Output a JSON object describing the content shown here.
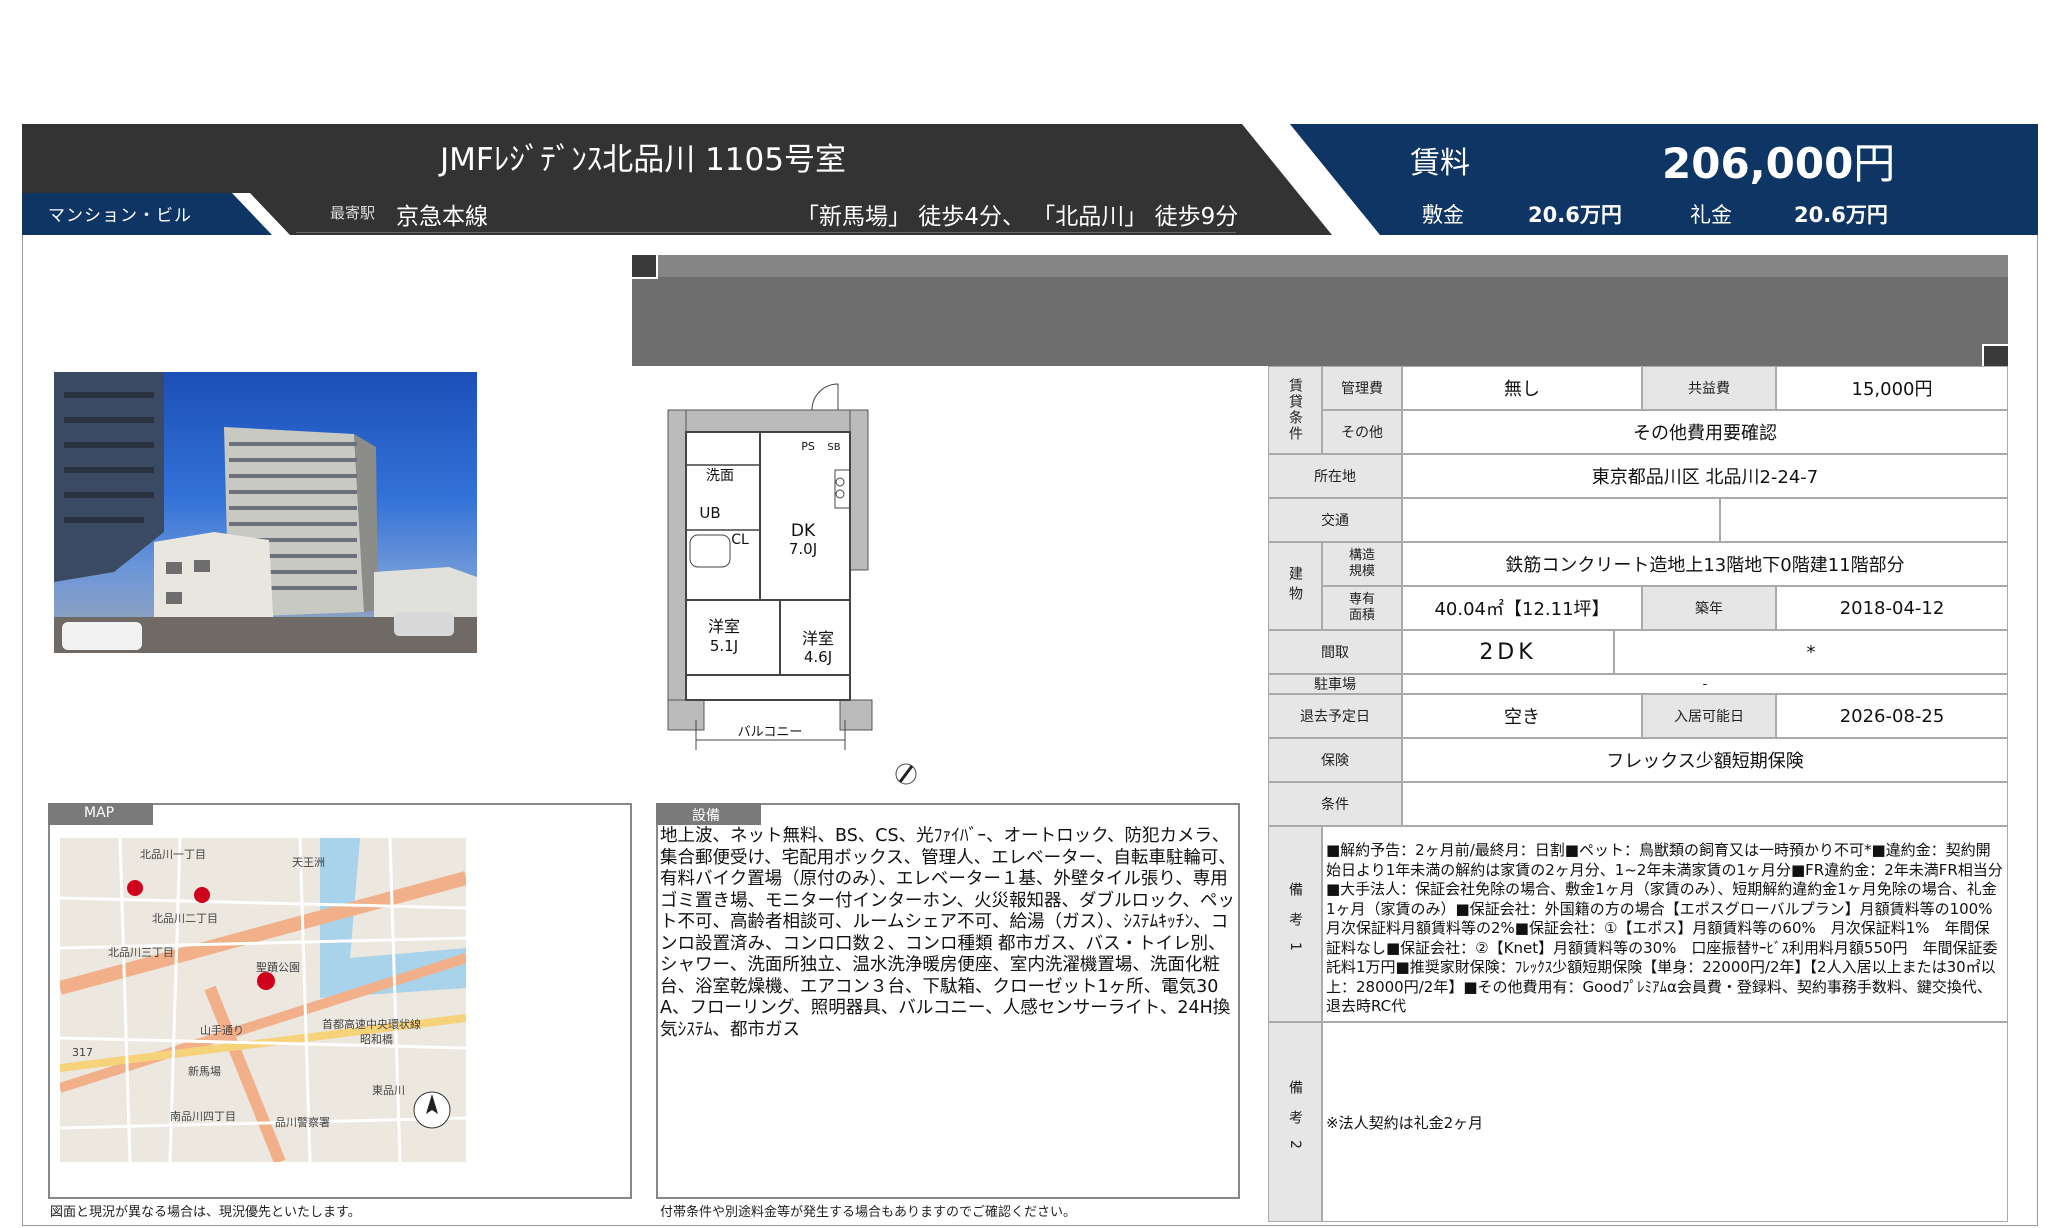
{
  "header": {
    "title": "JMFﾚｼﾞﾃﾞﾝｽ北品川 1105号室",
    "property_type": "マンション・ビル",
    "station_label": "最寄駅",
    "line": "京急本線",
    "access": "「新馬場」 徒歩4分、 「北品川」 徒歩9分",
    "rent_label": "賃料",
    "rent_value": "206,000",
    "rent_unit": "円",
    "deposit_label": "敷金",
    "deposit_value": "20.6万円",
    "key_money_label": "礼金",
    "key_money_value": "20.6万円"
  },
  "map_label": "MAP",
  "map_place_labels": [
    "天王洲",
    "北品川一丁目",
    "北品川二丁目",
    "北品川三丁目",
    "聖蹟公園",
    "山手通り",
    "首都高速中央環状線",
    "新馬場",
    "南品川四丁目",
    "東品川",
    "317",
    "昭和橋",
    "品川警察署"
  ],
  "equipment_label": "設備",
  "equipment_text": "地上波、ネット無料、BS、CS、光ﾌｧｲﾊﾞｰ、オートロック、防犯カメラ、集合郵便受け、宅配用ボックス、管理人、エレベーター、自転車駐輪可、有料バイク置場（原付のみ）、エレベーター１基、外壁タイル張り、専用ゴミ置き場、モニター付インターホン、火災報知器、ダブルロック、ペット不可、高齢者相談可、ルームシェア不可、給湯（ガス）、ｼｽﾃﾑｷｯﾁﾝ、コンロ設置済み、コンロ口数２、コンロ種類 都市ガス、バス・トイレ別、シャワー、洗面所独立、温水洗浄暖房便座、室内洗濯機置場、洗面化粧台、浴室乾燥機、エアコン３台、下駄箱、クローゼット1ヶ所、電気30A、フローリング、照明器具、バルコニー、人感センサーライト、24H換気ｼｽﾃﾑ、都市ガス",
  "floorplan": {
    "rooms": [
      "洗面",
      "UB",
      "CL",
      "DK",
      "7.0J",
      "洋室",
      "5.1J",
      "洋室",
      "4.6J",
      "バルコニー",
      "PS",
      "SB"
    ]
  },
  "footnotes": {
    "left": "図面と現況が異なる場合は、現況優先といたします。",
    "middle": "付帯条件や別途料金等が発生する場合もありますのでご確認ください。"
  },
  "table": {
    "rental_terms_label": "賃貸条件",
    "management_fee_label": "管理費",
    "management_fee": "無し",
    "common_fee_label": "共益費",
    "common_fee": "15,000円",
    "other_label": "その他",
    "other": "その他費用要確認",
    "address_label": "所在地",
    "address": "東京都品川区 北品川2-24-7",
    "transport_label": "交通",
    "transport": "",
    "building_label": "建物",
    "structure_label": "構造規模",
    "structure": "鉄筋コンクリート造地上13階地下0階建11階部分",
    "area_label": "専有面積",
    "area": "40.04㎡【12.11坪】",
    "built_label": "築年",
    "built": "2018-04-12",
    "layout_label": "間取",
    "layout": "2DK",
    "layout_note": "*",
    "parking_label": "駐車場",
    "parking": "-",
    "vacate_label": "退去予定日",
    "vacate": "空き",
    "move_in_label": "入居可能日",
    "move_in": "2026-08-25",
    "insurance_label": "保険",
    "insurance": "フレックス少額短期保険",
    "conditions_label": "条件",
    "conditions": "",
    "remarks1_label": "備考1",
    "remarks1": "■解約予告：2ヶ月前/最終月：日割■ペット：鳥獣類の飼育又は一時預かり不可*■違約金：契約開始日より1年未満の解約は家賃の2ヶ月分、1~2年未満家賃の1ヶ月分■FR違約金：2年未満FR相当分■大手法人：保証会社免除の場合、敷金1ヶ月（家賃のみ）、短期解約違約金1ヶ月免除の場合、礼金1ヶ月（家賃のみ）■保証会社：外国籍の方の場合【エポスグローバルプラン】月額賃料等の100%　月次保証料月額賃料等の2%■保証会社：①【エポス】月額賃料等の60%　月次保証料1%　年間保証料なし■保証会社：②【Knet】月額賃料等の30%　口座振替ｻｰﾋﾞｽ利用料月額550円　年間保証委託料1万円■推奨家財保険：ﾌﾚｯｸｽ少額短期保険【単身：22000円/2年】【2人入居以上または30㎡以上：28000円/2年】■その他費用有：Goodﾌﾟﾚﾐｱﾑα会員費・登録料、契約事務手数料、鍵交換代、退去時RC代",
    "remarks2_label": "備考2",
    "remarks2": "※法人契約は礼金2ヶ月"
  },
  "colors": {
    "header_dark": "#333333",
    "header_navy": "#0e3563",
    "table_header": "#e6e6e6"
  }
}
